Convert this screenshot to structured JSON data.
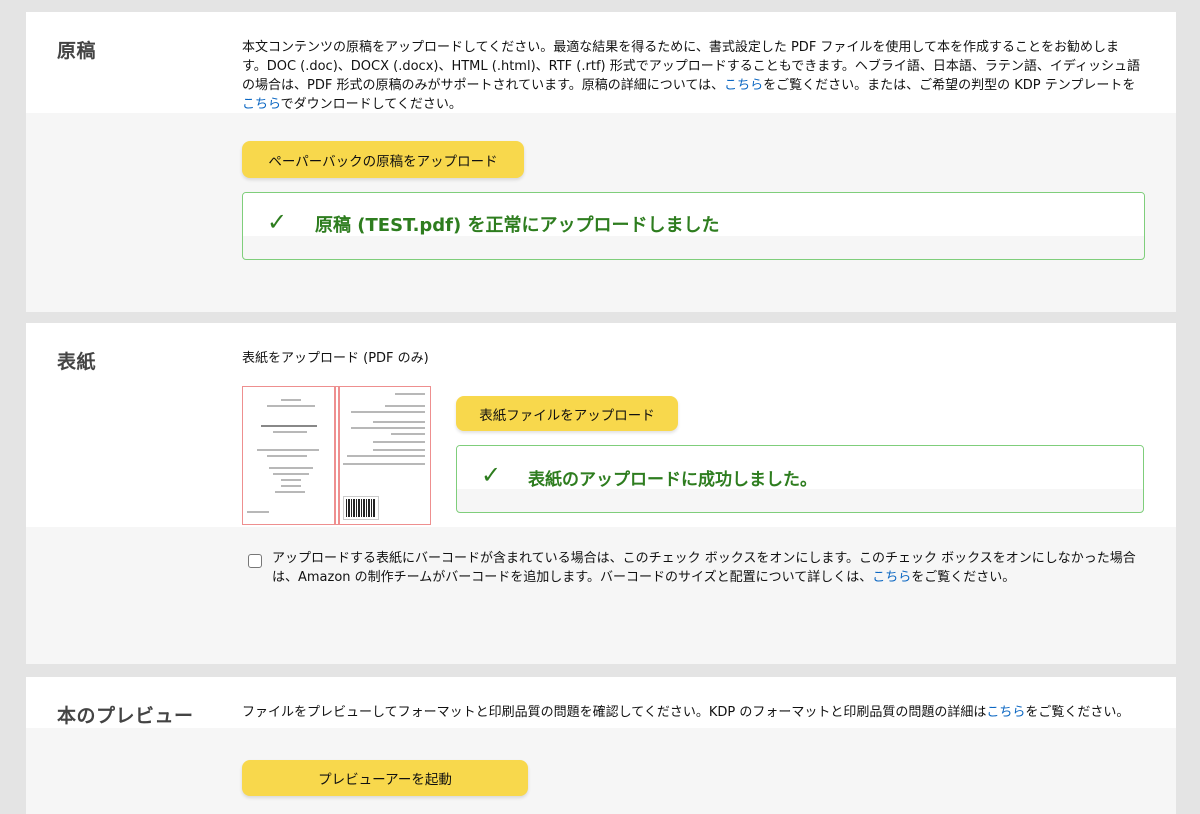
{
  "manuscript": {
    "title": "原稿",
    "desc_part1": "本文コンテンツの原稿をアップロードしてください。最適な結果を得るために、書式設定した PDF ファイルを使用して本を作成することをお勧めします。DOC (.doc)、DOCX (.docx)、HTML (.html)、RTF (.rtf) 形式でアップロードすることもできます。ヘブライ語、日本語、ラテン語、イディッシュ語の場合は、PDF 形式の原稿のみがサポートされています。原稿の詳細については、",
    "link1": "こちら",
    "desc_part2": "をご覧ください。または、ご希望の判型の KDP テンプレートを",
    "link2": "こちら",
    "desc_part3": "でダウンロードしてください。",
    "upload_button": "ペーパーバックの原稿をアップロード",
    "success_icon": "check-icon",
    "success_message": "原稿 (TEST.pdf) を正常にアップロードしました"
  },
  "cover": {
    "title": "表紙",
    "subtitle": "表紙をアップロード (PDF のみ)",
    "upload_button": "表紙ファイルをアップロード",
    "success_icon": "check-icon",
    "success_message": "表紙のアップロードに成功しました。",
    "barcode_text_part1": "アップロードする表紙にバーコードが含まれている場合は、このチェック ボックスをオンにします。このチェック ボックスをオンにしなかった場合は、Amazon の制作チームがバーコードを追加します。バーコードのサイズと配置について詳しくは、",
    "barcode_link": "こちら",
    "barcode_text_part2": "をご覧ください。",
    "barcode_checked": false
  },
  "preview": {
    "title": "本のプレビュー",
    "desc_part1": "ファイルをプレビューしてフォーマットと印刷品質の問題を確認してください。KDP のフォーマットと印刷品質の問題の詳細は",
    "link": "こちら",
    "desc_part2": "をご覧ください。",
    "button": "プレビューアーを起動"
  },
  "colors": {
    "button": "#f8d84c",
    "success": "#2e7d1f",
    "success_border": "#7fce7b",
    "link": "#0a66c2"
  }
}
